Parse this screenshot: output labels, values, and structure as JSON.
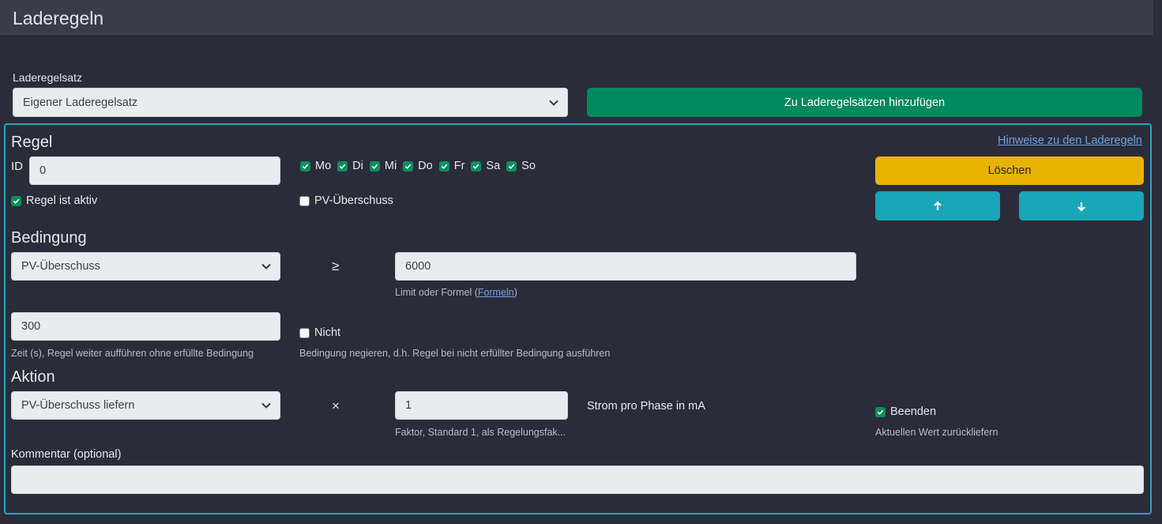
{
  "header": {
    "title": "Laderegeln"
  },
  "ruleset": {
    "label": "Laderegelsatz",
    "selected": "Eigener Laderegelsatz",
    "add_button": "Zu Laderegelsätzen hinzufügen"
  },
  "rule": {
    "heading": "Regel",
    "hints_link": "Hinweise zu den Laderegeln",
    "id_label": "ID",
    "id_value": "0",
    "active_label": "Regel ist aktiv",
    "active_checked": true,
    "days": [
      {
        "label": "Mo",
        "checked": true
      },
      {
        "label": "Di",
        "checked": true
      },
      {
        "label": "Mi",
        "checked": true
      },
      {
        "label": "Do",
        "checked": true
      },
      {
        "label": "Fr",
        "checked": true
      },
      {
        "label": "Sa",
        "checked": true
      },
      {
        "label": "So",
        "checked": true
      }
    ],
    "pv_label": "PV-Überschuss",
    "pv_checked": false,
    "delete_button": "Löschen"
  },
  "condition": {
    "heading": "Bedingung",
    "source_selected": "PV-Überschuss",
    "operator": "≥",
    "limit_value": "6000",
    "limit_help_prefix": "Limit oder Formel (",
    "limit_help_link": "Formeln",
    "limit_help_suffix": ")",
    "time_value": "300",
    "time_help": "Zeit (s), Regel weiter aufführen ohne erfüllte Bedingung",
    "not_label": "Nicht",
    "not_checked": false,
    "not_help": "Bedingung negieren, d.h. Regel bei nicht erfüllter Bedingung ausführen"
  },
  "action": {
    "heading": "Aktion",
    "type_selected": "PV-Überschuss liefern",
    "operator": "×",
    "factor_value": "1",
    "factor_help": "Faktor, Standard 1, als Regelungsfak...",
    "unit_label": "Strom pro Phase in mA",
    "stop_label": "Beenden",
    "stop_checked": true,
    "stop_help": "Aktuellen Wert zurückliefern"
  },
  "comment": {
    "label": "Kommentar (optional)",
    "value": ""
  },
  "colors": {
    "accent_green": "#008a5e",
    "warning_yellow": "#e8b300",
    "info_teal": "#1aa5b9",
    "panel_border": "#20a6bd"
  },
  "icons": {
    "chevron": "chevron-down-icon",
    "up": "arrow-up-icon",
    "down": "arrow-down-icon",
    "check": "check-icon"
  }
}
